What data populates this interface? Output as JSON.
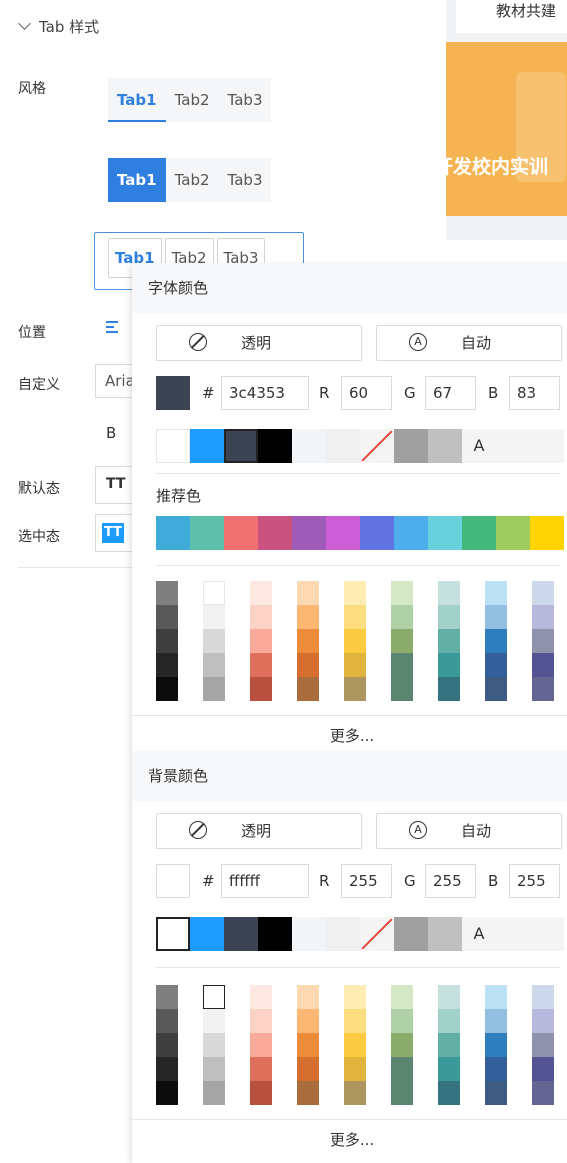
{
  "left_panel": {
    "section_title": "Tab 样式",
    "style_label": "风格",
    "position_label": "位置",
    "custom_label": "自定义",
    "custom_font": "Aria",
    "default_label": "默认态",
    "selected_label": "选中态",
    "bold_glyph": "B",
    "text_style_glyph": "TT",
    "tabs_variants": [
      [
        "Tab1",
        "Tab2",
        "Tab3"
      ],
      [
        "Tab1",
        "Tab2",
        "Tab3"
      ],
      [
        "Tab1",
        "Tab2",
        "Tab3"
      ]
    ]
  },
  "preview": {
    "tab_label": "教材共建",
    "banner_text": "开发校内实训"
  },
  "font_color": {
    "title": "字体颜色",
    "transparent_label": "透明",
    "auto_label": "自动",
    "hash": "#",
    "hex": "3c4353",
    "r_label": "R",
    "r": "60",
    "g_label": "G",
    "g": "67",
    "b_label": "B",
    "b": "83",
    "current_color": "#3c4353",
    "recommended_label": "推荐色",
    "more": "更多..."
  },
  "bg_color": {
    "title": "背景颜色",
    "transparent_label": "透明",
    "auto_label": "自动",
    "hash": "#",
    "hex": "ffffff",
    "r_label": "R",
    "r": "255",
    "g_label": "G",
    "g": "255",
    "b_label": "B",
    "b": "255",
    "current_color": "#ffffff",
    "more": "更多..."
  },
  "swatch_text": "A",
  "recent_colors": [
    "#ffffff",
    "#1e9bff",
    "#3c4353",
    "#000000",
    "#f2f5f8",
    "#f0f0f0",
    "transparent",
    "#a0a0a0",
    "#c0c0c0",
    "auto",
    "#f4f4f4",
    "#f4f4f4"
  ],
  "recommended_colors": [
    "#3eabd9",
    "#5ec0a8",
    "#ee7070",
    "#c9527f",
    "#9e5cb8",
    "#cc5fd6",
    "#6173e0",
    "#4eaeec",
    "#68d1dc",
    "#44b87c",
    "#9dcb5c",
    "#ffd400"
  ],
  "palette": [
    [
      "#7f7f7f",
      "#595959",
      "#3f3f3f",
      "#262626",
      "#0c0c0c"
    ],
    [
      "#ffffff",
      "#f2f2f2",
      "#d8d8d8",
      "#bfbfbf",
      "#a5a5a5"
    ],
    [
      "#fde9e1",
      "#fbd2c6",
      "#f9a999",
      "#de6f5a",
      "#b9503e"
    ],
    [
      "#fdd9b3",
      "#fdb774",
      "#ec8c3a",
      "#d46f30",
      "#a96c3d"
    ],
    [
      "#fdedb4",
      "#fcde80",
      "#fbcb40",
      "#e0b53b",
      "#ad9660"
    ],
    [
      "#d5e8c6",
      "#b0d1a7",
      "#8aab69",
      "#5a8570",
      "#5a8570"
    ],
    [
      "#c5e0dd",
      "#a1d1c8",
      "#61afa5",
      "#3a9999",
      "#367380"
    ],
    [
      "#bce1f5",
      "#93c0e0",
      "#2f7fbf",
      "#33609a",
      "#3d5a80"
    ],
    [
      "#cdd8ea",
      "#b8b7dc",
      "#8f91ad",
      "#545494",
      "#656593"
    ]
  ]
}
